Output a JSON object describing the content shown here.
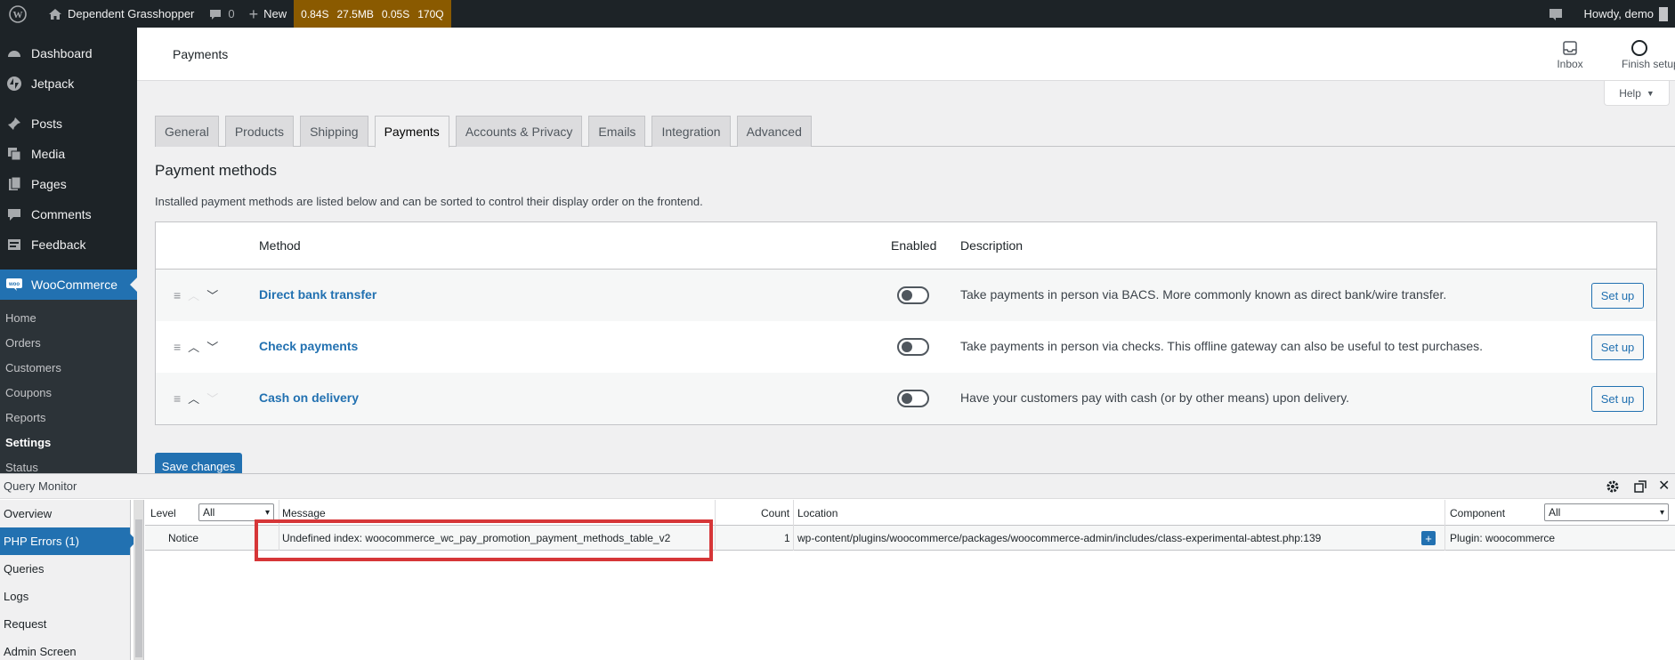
{
  "adminbar": {
    "site_name": "Dependent Grasshopper",
    "comments_count": "0",
    "new_label": "New",
    "qm_time": "0.84S",
    "qm_memory": "27.5MB",
    "qm_db_time": "0.05S",
    "qm_queries": "170Q",
    "howdy": "Howdy, demo"
  },
  "sidebar": {
    "items": [
      {
        "label": "Dashboard",
        "icon": "dashboard-icon"
      },
      {
        "label": "Jetpack",
        "icon": "jetpack-icon"
      },
      {
        "label": "Posts",
        "icon": "pin-icon"
      },
      {
        "label": "Media",
        "icon": "media-icon"
      },
      {
        "label": "Pages",
        "icon": "pages-icon"
      },
      {
        "label": "Comments",
        "icon": "comments-icon"
      },
      {
        "label": "Feedback",
        "icon": "feedback-icon"
      },
      {
        "label": "WooCommerce",
        "icon": "woo-icon"
      }
    ],
    "submenu": [
      "Home",
      "Orders",
      "Customers",
      "Coupons",
      "Reports",
      "Settings",
      "Status"
    ]
  },
  "header": {
    "title": "Payments",
    "inbox_label": "Inbox",
    "finish_label": "Finish setup",
    "help_label": "Help"
  },
  "tabs": [
    "General",
    "Products",
    "Shipping",
    "Payments",
    "Accounts & Privacy",
    "Emails",
    "Integration",
    "Advanced"
  ],
  "section": {
    "title": "Payment methods",
    "description": "Installed payment methods are listed below and can be sorted to control their display order on the frontend."
  },
  "table": {
    "col_method": "Method",
    "col_enabled": "Enabled",
    "col_description": "Description",
    "rows": [
      {
        "name": "Direct bank transfer",
        "description": "Take payments in person via BACS. More commonly known as direct bank/wire transfer.",
        "button": "Set up",
        "enabled": false
      },
      {
        "name": "Check payments",
        "description": "Take payments in person via checks. This offline gateway can also be useful to test purchases.",
        "button": "Set up",
        "enabled": false
      },
      {
        "name": "Cash on delivery",
        "description": "Have your customers pay with cash (or by other means) upon delivery.",
        "button": "Set up",
        "enabled": false
      }
    ]
  },
  "save_label": "Save changes",
  "qm": {
    "title": "Query Monitor",
    "nav": [
      "Overview",
      "PHP Errors (1)",
      "Queries",
      "Logs",
      "Request",
      "Admin Screen"
    ],
    "col_level": "Level",
    "level_filter": "All",
    "col_message": "Message",
    "col_count": "Count",
    "col_location": "Location",
    "col_component": "Component",
    "component_filter": "All",
    "row": {
      "level": "Notice",
      "message": "Undefined index: woocommerce_wc_pay_promotion_payment_methods_table_v2",
      "count": "1",
      "location": "wp-content/plugins/woocommerce/packages/woocommerce-admin/includes/class-experimental-abtest.php:139",
      "component": "Plugin: woocommerce"
    }
  },
  "colors": {
    "accent": "#2271b1",
    "adminbar": "#1d2327",
    "qm_bar": "#8a5a00",
    "highlight": "#d63638"
  }
}
